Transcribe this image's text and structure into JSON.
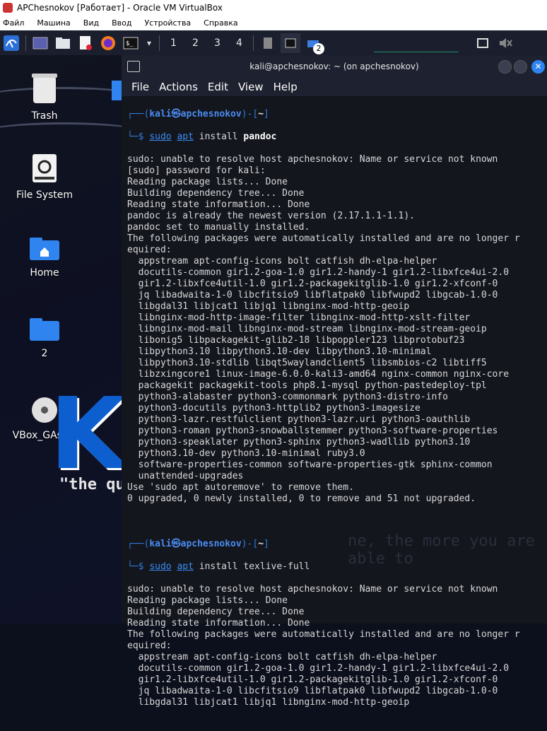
{
  "host": {
    "title": "APChesnokov [Работает] - Oracle VM VirtualBox",
    "menu": [
      "Файл",
      "Машина",
      "Вид",
      "Ввод",
      "Устройства",
      "Справка"
    ]
  },
  "panel": {
    "workspaces": [
      "1",
      "2",
      "3",
      "4"
    ],
    "badge": "2"
  },
  "desktop": {
    "icons": [
      {
        "label": "Trash"
      },
      {
        "label": "File System"
      },
      {
        "label": "Home"
      },
      {
        "label": "2"
      },
      {
        "label": "VBox_GAs_..."
      }
    ],
    "quote": "\"the qu",
    "watermark": "ne, the more you are able to"
  },
  "terminal": {
    "title": "kali@apchesnokov: ~ (on apchesnokov)",
    "menu": [
      "File",
      "Actions",
      "Edit",
      "View",
      "Help"
    ],
    "prompt_user": "kali㉿apchesnokov",
    "prompt_path": "~",
    "cmd1": {
      "sudo": "sudo",
      "apt": "apt",
      "install": "install",
      "pkg": "pandoc"
    },
    "output1": [
      "sudo: unable to resolve host apchesnokov: Name or service not known",
      "[sudo] password for kali:",
      "Reading package lists... Done",
      "Building dependency tree... Done",
      "Reading state information... Done",
      "pandoc is already the newest version (2.17.1.1-1.1).",
      "pandoc set to manually installed.",
      "The following packages were automatically installed and are no longer r",
      "equired:",
      "  appstream apt-config-icons bolt catfish dh-elpa-helper",
      "  docutils-common gir1.2-goa-1.0 gir1.2-handy-1 gir1.2-libxfce4ui-2.0",
      "  gir1.2-libxfce4util-1.0 gir1.2-packagekitglib-1.0 gir1.2-xfconf-0",
      "  jq libadwaita-1-0 libcfitsio9 libflatpak0 libfwupd2 libgcab-1.0-0",
      "  libgdal31 libjcat1 libjq1 libnginx-mod-http-geoip",
      "  libnginx-mod-http-image-filter libnginx-mod-http-xslt-filter",
      "  libnginx-mod-mail libnginx-mod-stream libnginx-mod-stream-geoip",
      "  libonig5 libpackagekit-glib2-18 libpoppler123 libprotobuf23",
      "  libpython3.10 libpython3.10-dev libpython3.10-minimal",
      "  libpython3.10-stdlib libqt5waylandclient5 libsmbios-c2 libtiff5",
      "  libzxingcore1 linux-image-6.0.0-kali3-amd64 nginx-common nginx-core",
      "  packagekit packagekit-tools php8.1-mysql python-pastedeploy-tpl",
      "  python3-alabaster python3-commonmark python3-distro-info",
      "  python3-docutils python3-httplib2 python3-imagesize",
      "  python3-lazr.restfulclient python3-lazr.uri python3-oauthlib",
      "  python3-roman python3-snowballstemmer python3-software-properties",
      "  python3-speaklater python3-sphinx python3-wadllib python3.10",
      "  python3.10-dev python3.10-minimal ruby3.0",
      "  software-properties-common software-properties-gtk sphinx-common",
      "  unattended-upgrades",
      "Use 'sudo apt autoremove' to remove them.",
      "0 upgraded, 0 newly installed, 0 to remove and 51 not upgraded."
    ],
    "cmd2": {
      "sudo": "sudo",
      "apt": "apt",
      "install": "install",
      "pkg": "texlive-full"
    },
    "output2": [
      "sudo: unable to resolve host apchesnokov: Name or service not known",
      "Reading package lists... Done",
      "Building dependency tree... Done",
      "Reading state information... Done",
      "The following packages were automatically installed and are no longer r",
      "equired:",
      "  appstream apt-config-icons bolt catfish dh-elpa-helper",
      "  docutils-common gir1.2-goa-1.0 gir1.2-handy-1 gir1.2-libxfce4ui-2.0",
      "  gir1.2-libxfce4util-1.0 gir1.2-packagekitglib-1.0 gir1.2-xfconf-0",
      "  jq libadwaita-1-0 libcfitsio9 libflatpak0 libfwupd2 libgcab-1.0-0",
      "  libgdal31 libjcat1 libjq1 libnginx-mod-http-geoip"
    ]
  }
}
